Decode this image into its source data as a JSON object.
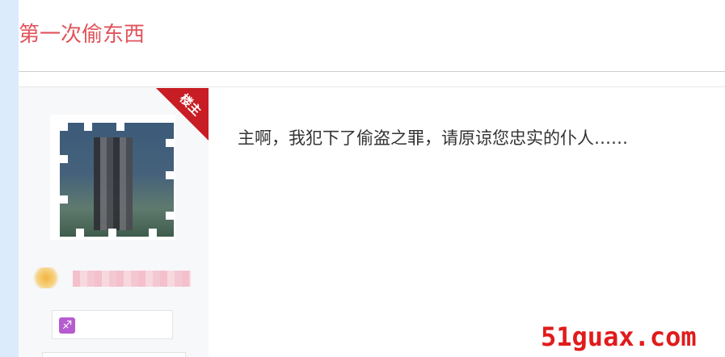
{
  "thread": {
    "title": "第一次偷东西"
  },
  "post": {
    "author_tag": "楼主",
    "body": "主啊，我犯下了偷盗之罪，请原谅您忠实的仆人……"
  },
  "author": {
    "zodiac_icon": "sagittarius-icon",
    "zodiac_glyph": "♐"
  },
  "watermark": {
    "text": "51guax.com"
  },
  "colors": {
    "title": "#e1535b",
    "ribbon": "#c81d24",
    "watermark": "#e11b1b",
    "left_rail": "#dcebfb"
  }
}
